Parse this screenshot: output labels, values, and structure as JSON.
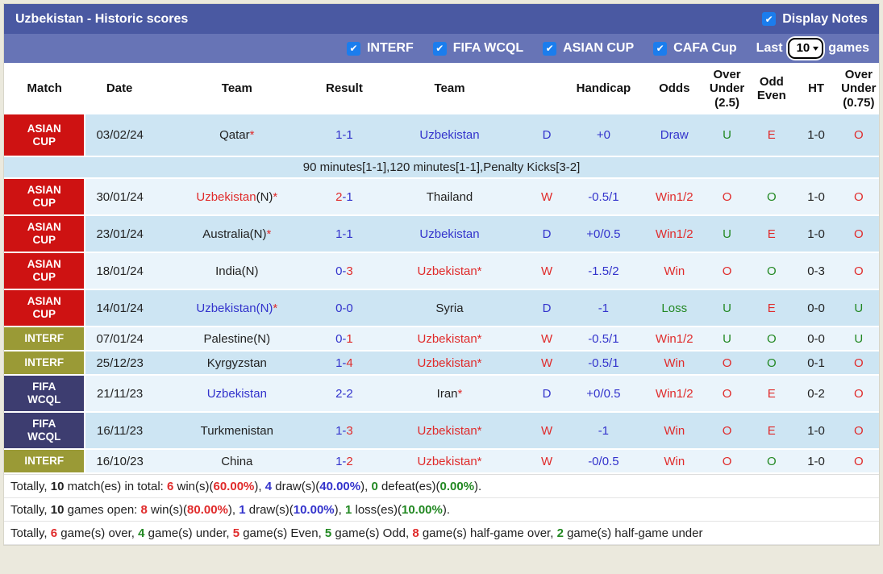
{
  "titlebar": {
    "title": "Uzbekistan - Historic scores",
    "display_notes": {
      "label": "Display Notes",
      "checked": true
    }
  },
  "filterbar": {
    "filters": [
      {
        "label": "INTERF",
        "checked": true
      },
      {
        "label": "FIFA WCQL",
        "checked": true
      },
      {
        "label": "ASIAN CUP",
        "checked": true
      },
      {
        "label": "CAFA Cup",
        "checked": true
      }
    ],
    "last_label": "Last",
    "last_value": "10",
    "games_label": "games"
  },
  "icons": {
    "check": "✔",
    "chevron_down": "▾"
  },
  "colors": {
    "titlebar": "#4a59a2",
    "filterbar": "#6774b6",
    "checkbox": "#1b7ded",
    "badge_red": "#ce1212",
    "badge_olive": "#9a9a36",
    "badge_navy": "#3d3d70",
    "row_blue": "#cde5f3",
    "row_light": "#eaf4fb",
    "text_blue": "#3333cc",
    "text_red": "#e02b2b",
    "text_green": "#228822"
  },
  "table": {
    "headers": [
      {
        "lines": [
          "Match"
        ]
      },
      {
        "lines": [
          "Date"
        ]
      },
      {
        "lines": [
          "Team"
        ]
      },
      {
        "lines": [
          "Result"
        ]
      },
      {
        "lines": [
          "Team"
        ]
      },
      {
        "lines": [
          ""
        ]
      },
      {
        "lines": [
          "Handicap"
        ]
      },
      {
        "lines": [
          "Odds"
        ]
      },
      {
        "lines": [
          "Over",
          "Under",
          "(2.5)"
        ]
      },
      {
        "lines": [
          "Odd",
          "Even"
        ]
      },
      {
        "lines": [
          "HT"
        ]
      },
      {
        "lines": [
          "Over",
          "Under",
          "(0.75)"
        ]
      }
    ],
    "rows": [
      {
        "badge": {
          "label": "ASIAN CUP",
          "lines": [
            "ASIAN",
            "CUP"
          ],
          "color": "red"
        },
        "shade": "blue",
        "size": "first",
        "date": "03/02/24",
        "team1": [
          {
            "t": "Qatar"
          },
          {
            "t": "*",
            "c": "red"
          }
        ],
        "result": [
          {
            "t": "1-1",
            "c": "blue"
          }
        ],
        "team2": [
          {
            "t": "Uzbekistan",
            "c": "blue"
          }
        ],
        "wdl": [
          {
            "t": "D",
            "c": "blue"
          }
        ],
        "handicap": [
          {
            "t": "+0",
            "c": "blue"
          }
        ],
        "odds": [
          {
            "t": "Draw",
            "c": "blue"
          }
        ],
        "ou25": [
          {
            "t": "U",
            "c": "green"
          }
        ],
        "oddeven": [
          {
            "t": "E",
            "c": "red"
          }
        ],
        "ht": [
          {
            "t": "1-0"
          }
        ],
        "ou075": [
          {
            "t": "O",
            "c": "red"
          }
        ],
        "note": "90 minutes[1-1],120 minutes[1-1],Penalty Kicks[3-2]"
      },
      {
        "badge": {
          "label": "ASIAN CUP",
          "lines": [
            "ASIAN",
            "CUP"
          ],
          "color": "red"
        },
        "shade": "light",
        "size": "tall",
        "date": "30/01/24",
        "team1": [
          {
            "t": "Uzbekistan",
            "c": "red"
          },
          {
            "t": "(N)"
          },
          {
            "t": "*",
            "c": "red"
          }
        ],
        "result": [
          {
            "t": "2",
            "c": "red"
          },
          {
            "t": "-1",
            "c": "blue"
          }
        ],
        "team2": [
          {
            "t": "Thailand"
          }
        ],
        "wdl": [
          {
            "t": "W",
            "c": "red"
          }
        ],
        "handicap": [
          {
            "t": "-0.5/1",
            "c": "blue"
          }
        ],
        "odds": [
          {
            "t": "Win1/2",
            "c": "red"
          }
        ],
        "ou25": [
          {
            "t": "O",
            "c": "red"
          }
        ],
        "oddeven": [
          {
            "t": "O",
            "c": "green"
          }
        ],
        "ht": [
          {
            "t": "1-0"
          }
        ],
        "ou075": [
          {
            "t": "O",
            "c": "red"
          }
        ]
      },
      {
        "badge": {
          "label": "ASIAN CUP",
          "lines": [
            "ASIAN",
            "CUP"
          ],
          "color": "red"
        },
        "shade": "blue",
        "size": "tall",
        "date": "23/01/24",
        "team1": [
          {
            "t": "Australia(N)"
          },
          {
            "t": "*",
            "c": "red"
          }
        ],
        "result": [
          {
            "t": "1-1",
            "c": "blue"
          }
        ],
        "team2": [
          {
            "t": "Uzbekistan",
            "c": "blue"
          }
        ],
        "wdl": [
          {
            "t": "D",
            "c": "blue"
          }
        ],
        "handicap": [
          {
            "t": "+0/0.5",
            "c": "blue"
          }
        ],
        "odds": [
          {
            "t": "Win1/2",
            "c": "red"
          }
        ],
        "ou25": [
          {
            "t": "U",
            "c": "green"
          }
        ],
        "oddeven": [
          {
            "t": "E",
            "c": "red"
          }
        ],
        "ht": [
          {
            "t": "1-0"
          }
        ],
        "ou075": [
          {
            "t": "O",
            "c": "red"
          }
        ]
      },
      {
        "badge": {
          "label": "ASIAN CUP",
          "lines": [
            "ASIAN",
            "CUP"
          ],
          "color": "red"
        },
        "shade": "light",
        "size": "tall",
        "date": "18/01/24",
        "team1": [
          {
            "t": "India(N)"
          }
        ],
        "result": [
          {
            "t": "0-",
            "c": "blue"
          },
          {
            "t": "3",
            "c": "red"
          }
        ],
        "team2": [
          {
            "t": "Uzbekistan*",
            "c": "red"
          }
        ],
        "wdl": [
          {
            "t": "W",
            "c": "red"
          }
        ],
        "handicap": [
          {
            "t": "-1.5/2",
            "c": "blue"
          }
        ],
        "odds": [
          {
            "t": "Win",
            "c": "red"
          }
        ],
        "ou25": [
          {
            "t": "O",
            "c": "red"
          }
        ],
        "oddeven": [
          {
            "t": "O",
            "c": "green"
          }
        ],
        "ht": [
          {
            "t": "0-3"
          }
        ],
        "ou075": [
          {
            "t": "O",
            "c": "red"
          }
        ]
      },
      {
        "badge": {
          "label": "ASIAN CUP",
          "lines": [
            "ASIAN",
            "CUP"
          ],
          "color": "red"
        },
        "shade": "blue",
        "size": "tall",
        "date": "14/01/24",
        "team1": [
          {
            "t": "Uzbekistan(N)",
            "c": "blue"
          },
          {
            "t": "*",
            "c": "red"
          }
        ],
        "result": [
          {
            "t": "0-0",
            "c": "blue"
          }
        ],
        "team2": [
          {
            "t": "Syria"
          }
        ],
        "wdl": [
          {
            "t": "D",
            "c": "blue"
          }
        ],
        "handicap": [
          {
            "t": "-1",
            "c": "blue"
          }
        ],
        "odds": [
          {
            "t": "Loss",
            "c": "green"
          }
        ],
        "ou25": [
          {
            "t": "U",
            "c": "green"
          }
        ],
        "oddeven": [
          {
            "t": "E",
            "c": "red"
          }
        ],
        "ht": [
          {
            "t": "0-0"
          }
        ],
        "ou075": [
          {
            "t": "U",
            "c": "green"
          }
        ]
      },
      {
        "badge": {
          "label": "INTERF",
          "lines": [
            "INTERF"
          ],
          "color": "olive"
        },
        "shade": "light",
        "size": "short",
        "date": "07/01/24",
        "team1": [
          {
            "t": "Palestine(N)"
          }
        ],
        "result": [
          {
            "t": "0-",
            "c": "blue"
          },
          {
            "t": "1",
            "c": "red"
          }
        ],
        "team2": [
          {
            "t": "Uzbekistan*",
            "c": "red"
          }
        ],
        "wdl": [
          {
            "t": "W",
            "c": "red"
          }
        ],
        "handicap": [
          {
            "t": "-0.5/1",
            "c": "blue"
          }
        ],
        "odds": [
          {
            "t": "Win1/2",
            "c": "red"
          }
        ],
        "ou25": [
          {
            "t": "U",
            "c": "green"
          }
        ],
        "oddeven": [
          {
            "t": "O",
            "c": "green"
          }
        ],
        "ht": [
          {
            "t": "0-0"
          }
        ],
        "ou075": [
          {
            "t": "U",
            "c": "green"
          }
        ]
      },
      {
        "badge": {
          "label": "INTERF",
          "lines": [
            "INTERF"
          ],
          "color": "olive"
        },
        "shade": "blue",
        "size": "short",
        "date": "25/12/23",
        "team1": [
          {
            "t": "Kyrgyzstan"
          }
        ],
        "result": [
          {
            "t": "1-",
            "c": "blue"
          },
          {
            "t": "4",
            "c": "red"
          }
        ],
        "team2": [
          {
            "t": "Uzbekistan*",
            "c": "red"
          }
        ],
        "wdl": [
          {
            "t": "W",
            "c": "red"
          }
        ],
        "handicap": [
          {
            "t": "-0.5/1",
            "c": "blue"
          }
        ],
        "odds": [
          {
            "t": "Win",
            "c": "red"
          }
        ],
        "ou25": [
          {
            "t": "O",
            "c": "red"
          }
        ],
        "oddeven": [
          {
            "t": "O",
            "c": "green"
          }
        ],
        "ht": [
          {
            "t": "0-1"
          }
        ],
        "ou075": [
          {
            "t": "O",
            "c": "red"
          }
        ]
      },
      {
        "badge": {
          "label": "FIFA WCQL",
          "lines": [
            "FIFA",
            "WCQL"
          ],
          "color": "navy"
        },
        "shade": "light",
        "size": "tall",
        "date": "21/11/23",
        "team1": [
          {
            "t": "Uzbekistan",
            "c": "blue"
          }
        ],
        "result": [
          {
            "t": "2-2",
            "c": "blue"
          }
        ],
        "team2": [
          {
            "t": "Iran"
          },
          {
            "t": "*",
            "c": "red"
          }
        ],
        "wdl": [
          {
            "t": "D",
            "c": "blue"
          }
        ],
        "handicap": [
          {
            "t": "+0/0.5",
            "c": "blue"
          }
        ],
        "odds": [
          {
            "t": "Win1/2",
            "c": "red"
          }
        ],
        "ou25": [
          {
            "t": "O",
            "c": "red"
          }
        ],
        "oddeven": [
          {
            "t": "E",
            "c": "red"
          }
        ],
        "ht": [
          {
            "t": "0-2"
          }
        ],
        "ou075": [
          {
            "t": "O",
            "c": "red"
          }
        ]
      },
      {
        "badge": {
          "label": "FIFA WCQL",
          "lines": [
            "FIFA",
            "WCQL"
          ],
          "color": "navy"
        },
        "shade": "blue",
        "size": "tall",
        "date": "16/11/23",
        "team1": [
          {
            "t": "Turkmenistan"
          }
        ],
        "result": [
          {
            "t": "1-",
            "c": "blue"
          },
          {
            "t": "3",
            "c": "red"
          }
        ],
        "team2": [
          {
            "t": "Uzbekistan*",
            "c": "red"
          }
        ],
        "wdl": [
          {
            "t": "W",
            "c": "red"
          }
        ],
        "handicap": [
          {
            "t": "-1",
            "c": "blue"
          }
        ],
        "odds": [
          {
            "t": "Win",
            "c": "red"
          }
        ],
        "ou25": [
          {
            "t": "O",
            "c": "red"
          }
        ],
        "oddeven": [
          {
            "t": "E",
            "c": "red"
          }
        ],
        "ht": [
          {
            "t": "1-0"
          }
        ],
        "ou075": [
          {
            "t": "O",
            "c": "red"
          }
        ]
      },
      {
        "badge": {
          "label": "INTERF",
          "lines": [
            "INTERF"
          ],
          "color": "olive"
        },
        "shade": "light",
        "size": "short",
        "date": "16/10/23",
        "team1": [
          {
            "t": "China"
          }
        ],
        "result": [
          {
            "t": "1-",
            "c": "blue"
          },
          {
            "t": "2",
            "c": "red"
          }
        ],
        "team2": [
          {
            "t": "Uzbekistan*",
            "c": "red"
          }
        ],
        "wdl": [
          {
            "t": "W",
            "c": "red"
          }
        ],
        "handicap": [
          {
            "t": "-0/0.5",
            "c": "blue"
          }
        ],
        "odds": [
          {
            "t": "Win",
            "c": "red"
          }
        ],
        "ou25": [
          {
            "t": "O",
            "c": "red"
          }
        ],
        "oddeven": [
          {
            "t": "O",
            "c": "green"
          }
        ],
        "ht": [
          {
            "t": "1-0"
          }
        ],
        "ou075": [
          {
            "t": "O",
            "c": "red"
          }
        ]
      }
    ]
  },
  "summary": {
    "lines": [
      [
        {
          "t": "Totally, "
        },
        {
          "t": "10",
          "b": true
        },
        {
          "t": " match(es) in total: "
        },
        {
          "t": "6",
          "c": "red",
          "b": true
        },
        {
          "t": " win(s)("
        },
        {
          "t": "60.00%",
          "c": "red",
          "b": true
        },
        {
          "t": "), "
        },
        {
          "t": "4",
          "c": "blue",
          "b": true
        },
        {
          "t": " draw(s)("
        },
        {
          "t": "40.00%",
          "c": "blue",
          "b": true
        },
        {
          "t": "), "
        },
        {
          "t": "0",
          "c": "green",
          "b": true
        },
        {
          "t": " defeat(es)("
        },
        {
          "t": "0.00%",
          "c": "green",
          "b": true
        },
        {
          "t": ")."
        }
      ],
      [
        {
          "t": "Totally, "
        },
        {
          "t": "10",
          "b": true
        },
        {
          "t": " games open: "
        },
        {
          "t": "8",
          "c": "red",
          "b": true
        },
        {
          "t": " win(s)("
        },
        {
          "t": "80.00%",
          "c": "red",
          "b": true
        },
        {
          "t": "), "
        },
        {
          "t": "1",
          "c": "blue",
          "b": true
        },
        {
          "t": " draw(s)("
        },
        {
          "t": "10.00%",
          "c": "blue",
          "b": true
        },
        {
          "t": "), "
        },
        {
          "t": "1",
          "c": "green",
          "b": true
        },
        {
          "t": " loss(es)("
        },
        {
          "t": "10.00%",
          "c": "green",
          "b": true
        },
        {
          "t": ")."
        }
      ],
      [
        {
          "t": "Totally, "
        },
        {
          "t": "6",
          "c": "red",
          "b": true
        },
        {
          "t": " game(s) over, "
        },
        {
          "t": "4",
          "c": "green",
          "b": true
        },
        {
          "t": " game(s) under, "
        },
        {
          "t": "5",
          "c": "red",
          "b": true
        },
        {
          "t": " game(s) Even, "
        },
        {
          "t": "5",
          "c": "green",
          "b": true
        },
        {
          "t": " game(s) Odd, "
        },
        {
          "t": "8",
          "c": "red",
          "b": true
        },
        {
          "t": " game(s) half-game over, "
        },
        {
          "t": "2",
          "c": "green",
          "b": true
        },
        {
          "t": " game(s) half-game under"
        }
      ]
    ]
  }
}
